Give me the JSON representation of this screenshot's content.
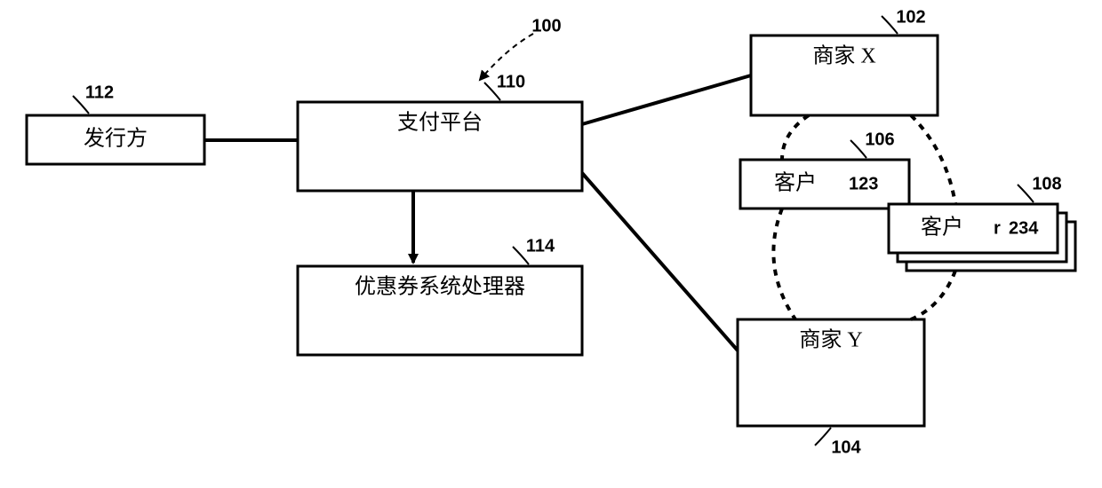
{
  "diagram": {
    "ref_overall": "100",
    "issuer": {
      "label": "发行方",
      "ref": "112"
    },
    "platform": {
      "label": "支付平台",
      "ref": "110"
    },
    "coupon": {
      "label": "优惠券系统处理器",
      "ref": "114"
    },
    "merchant_x": {
      "label": "商家 X",
      "ref": "102"
    },
    "merchant_y": {
      "label": "商家 Y",
      "ref": "104"
    },
    "customer_a": {
      "label": "客户",
      "id": "123",
      "ref": "106"
    },
    "customer_b": {
      "label": "客户",
      "id": "234",
      "ref": "108"
    }
  }
}
